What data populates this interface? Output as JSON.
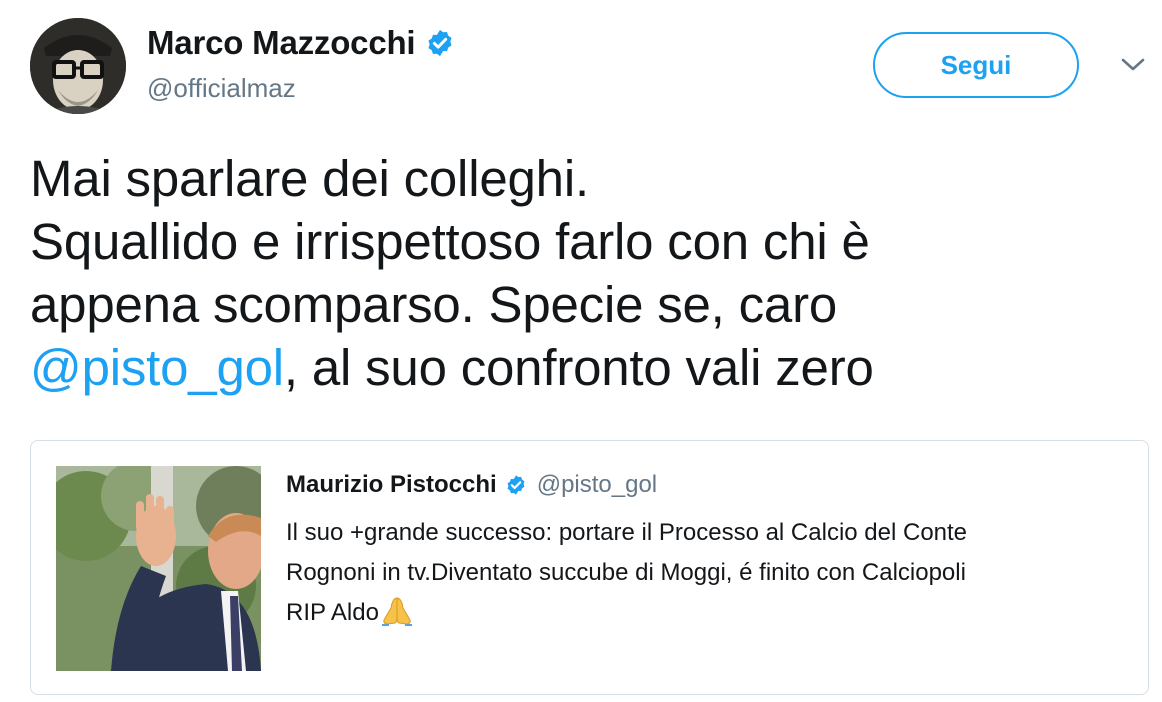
{
  "author": {
    "display_name": "Marco Mazzocchi",
    "handle": "@officialmaz",
    "avatar_icon": "avatar-photo",
    "verified": true
  },
  "follow_button": {
    "label": "Segui"
  },
  "menu_icon": "chevron-down-icon",
  "tweet": {
    "lines": [
      "Mai sparlare dei colleghi.",
      "Squallido e irrispettoso farlo con chi è",
      "appena scomparso. Specie se, caro"
    ],
    "mention": "@pisto_gol",
    "last_line_rest": ", al suo confronto vali zero"
  },
  "quoted_tweet": {
    "display_name": "Maurizio Pistocchi",
    "handle": "@pisto_gol",
    "verified": true,
    "lines": [
      "Il suo +grande successo: portare il Processo al Calcio del Conte",
      "Rognoni in tv.Diventato succube di Moggi, é finito con Calciopoli",
      "RIP Aldo"
    ],
    "emoji": "folded-hands-emoji",
    "image": "photo-man-waving"
  },
  "colors": {
    "accent": "#1da1f2",
    "text": "#14171a",
    "secondary_text": "#657786",
    "border": "#d6dfe6"
  }
}
